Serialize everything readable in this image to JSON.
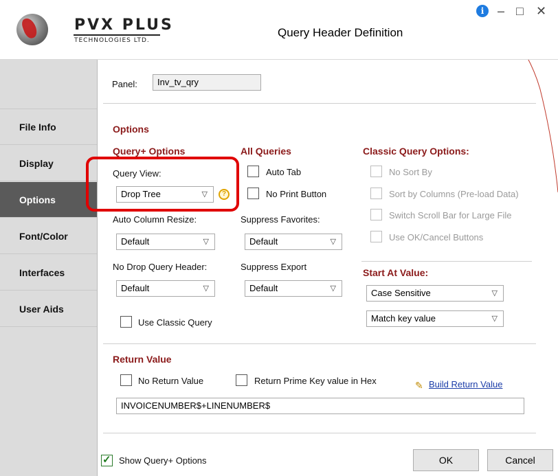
{
  "window": {
    "title": "Query Header Definition",
    "controls": {
      "minimize": "–",
      "maximize": "□",
      "close": "✕"
    },
    "info_icon": "i"
  },
  "logo": {
    "name": "PVX PLUS",
    "subtitle": "TECHNOLOGIES LTD."
  },
  "sidebar": {
    "items": [
      {
        "label": "File Info"
      },
      {
        "label": "Display"
      },
      {
        "label": "Options",
        "active": true
      },
      {
        "label": "Font/Color"
      },
      {
        "label": "Interfaces"
      },
      {
        "label": "User Aids"
      }
    ]
  },
  "panel": {
    "label": "Panel:",
    "value": "Inv_tv_qry"
  },
  "options": {
    "heading": "Options",
    "query_plus": {
      "heading": "Query+ Options",
      "query_view_label": "Query View:",
      "query_view_value": "Drop Tree",
      "auto_column_resize_label": "Auto Column Resize:",
      "auto_column_resize_value": "Default",
      "no_drop_query_header_label": "No Drop Query Header:",
      "no_drop_query_header_value": "Default",
      "use_classic_query_label": "Use Classic Query",
      "use_classic_query_checked": false
    },
    "all_queries": {
      "heading": "All Queries",
      "auto_tab_label": "Auto Tab",
      "no_print_button_label": "No Print Button",
      "suppress_favorites_label": "Suppress Favorites:",
      "suppress_favorites_value": "Default",
      "suppress_export_label": "Suppress Export",
      "suppress_export_value": "Default"
    },
    "classic": {
      "heading": "Classic Query Options:",
      "no_sort_by": "No Sort By",
      "sort_by_columns": "Sort by Columns (Pre-load Data)",
      "switch_scroll_bar": "Switch Scroll Bar for Large File",
      "use_ok_cancel": "Use OK/Cancel Buttons"
    },
    "start_at": {
      "heading": "Start At Value:",
      "case_value": "Case Sensitive",
      "match_value": "Match key value"
    }
  },
  "return_value": {
    "heading": "Return Value",
    "no_return_value_label": "No Return Value",
    "return_prime_key_label": "Return Prime Key value in Hex",
    "build_link": "Build Return Value",
    "expression": "INVOICENUMBER$+LINENUMBER$"
  },
  "footer": {
    "show_query_plus_label": "Show Query+ Options",
    "show_query_plus_checked": true,
    "ok_label": "OK",
    "cancel_label": "Cancel"
  },
  "colors": {
    "section_heading": "#8b1a1a",
    "highlight": "#e00000",
    "sidebar_active": "#5a5a5a"
  }
}
